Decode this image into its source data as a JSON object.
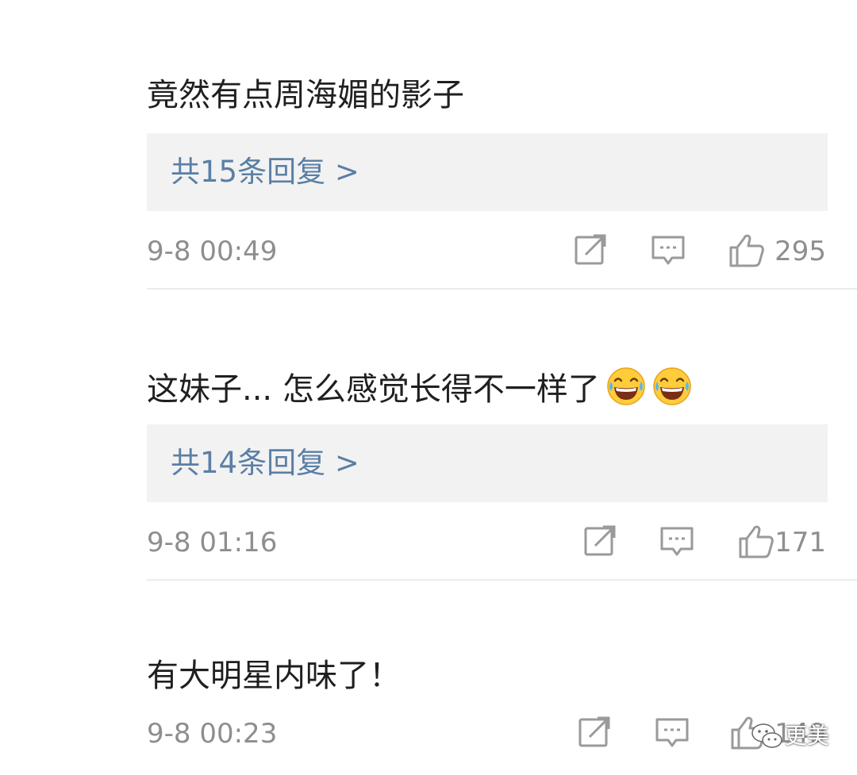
{
  "colors": {
    "reply_link": "#5a7fa6",
    "meta_text": "#8e8e8e",
    "reply_bg": "#f2f2f2",
    "icon_stroke": "#9a9a9a"
  },
  "comments": [
    {
      "text": "竟然有点周海媚的影子",
      "reply_label": "共15条回复 >",
      "time": "9-8 00:49",
      "likes": "295",
      "emojis": []
    },
    {
      "text": "这妹子... 怎么感觉长得不一样了",
      "reply_label": "共14条回复 >",
      "time": "9-8 01:16",
      "likes": "171",
      "emojis": [
        "laughing-tears",
        "laughing-tears"
      ]
    },
    {
      "text": "有大明星内味了！",
      "time": "9-8 00:23",
      "likes": "149"
    }
  ],
  "icons": {
    "share": "share-icon",
    "comment": "comment-icon",
    "like": "thumbs-up-icon",
    "emoji": "laughing-tears-emoji-icon",
    "watermark": "wechat-logo-icon"
  },
  "watermark": {
    "text": "更美"
  }
}
